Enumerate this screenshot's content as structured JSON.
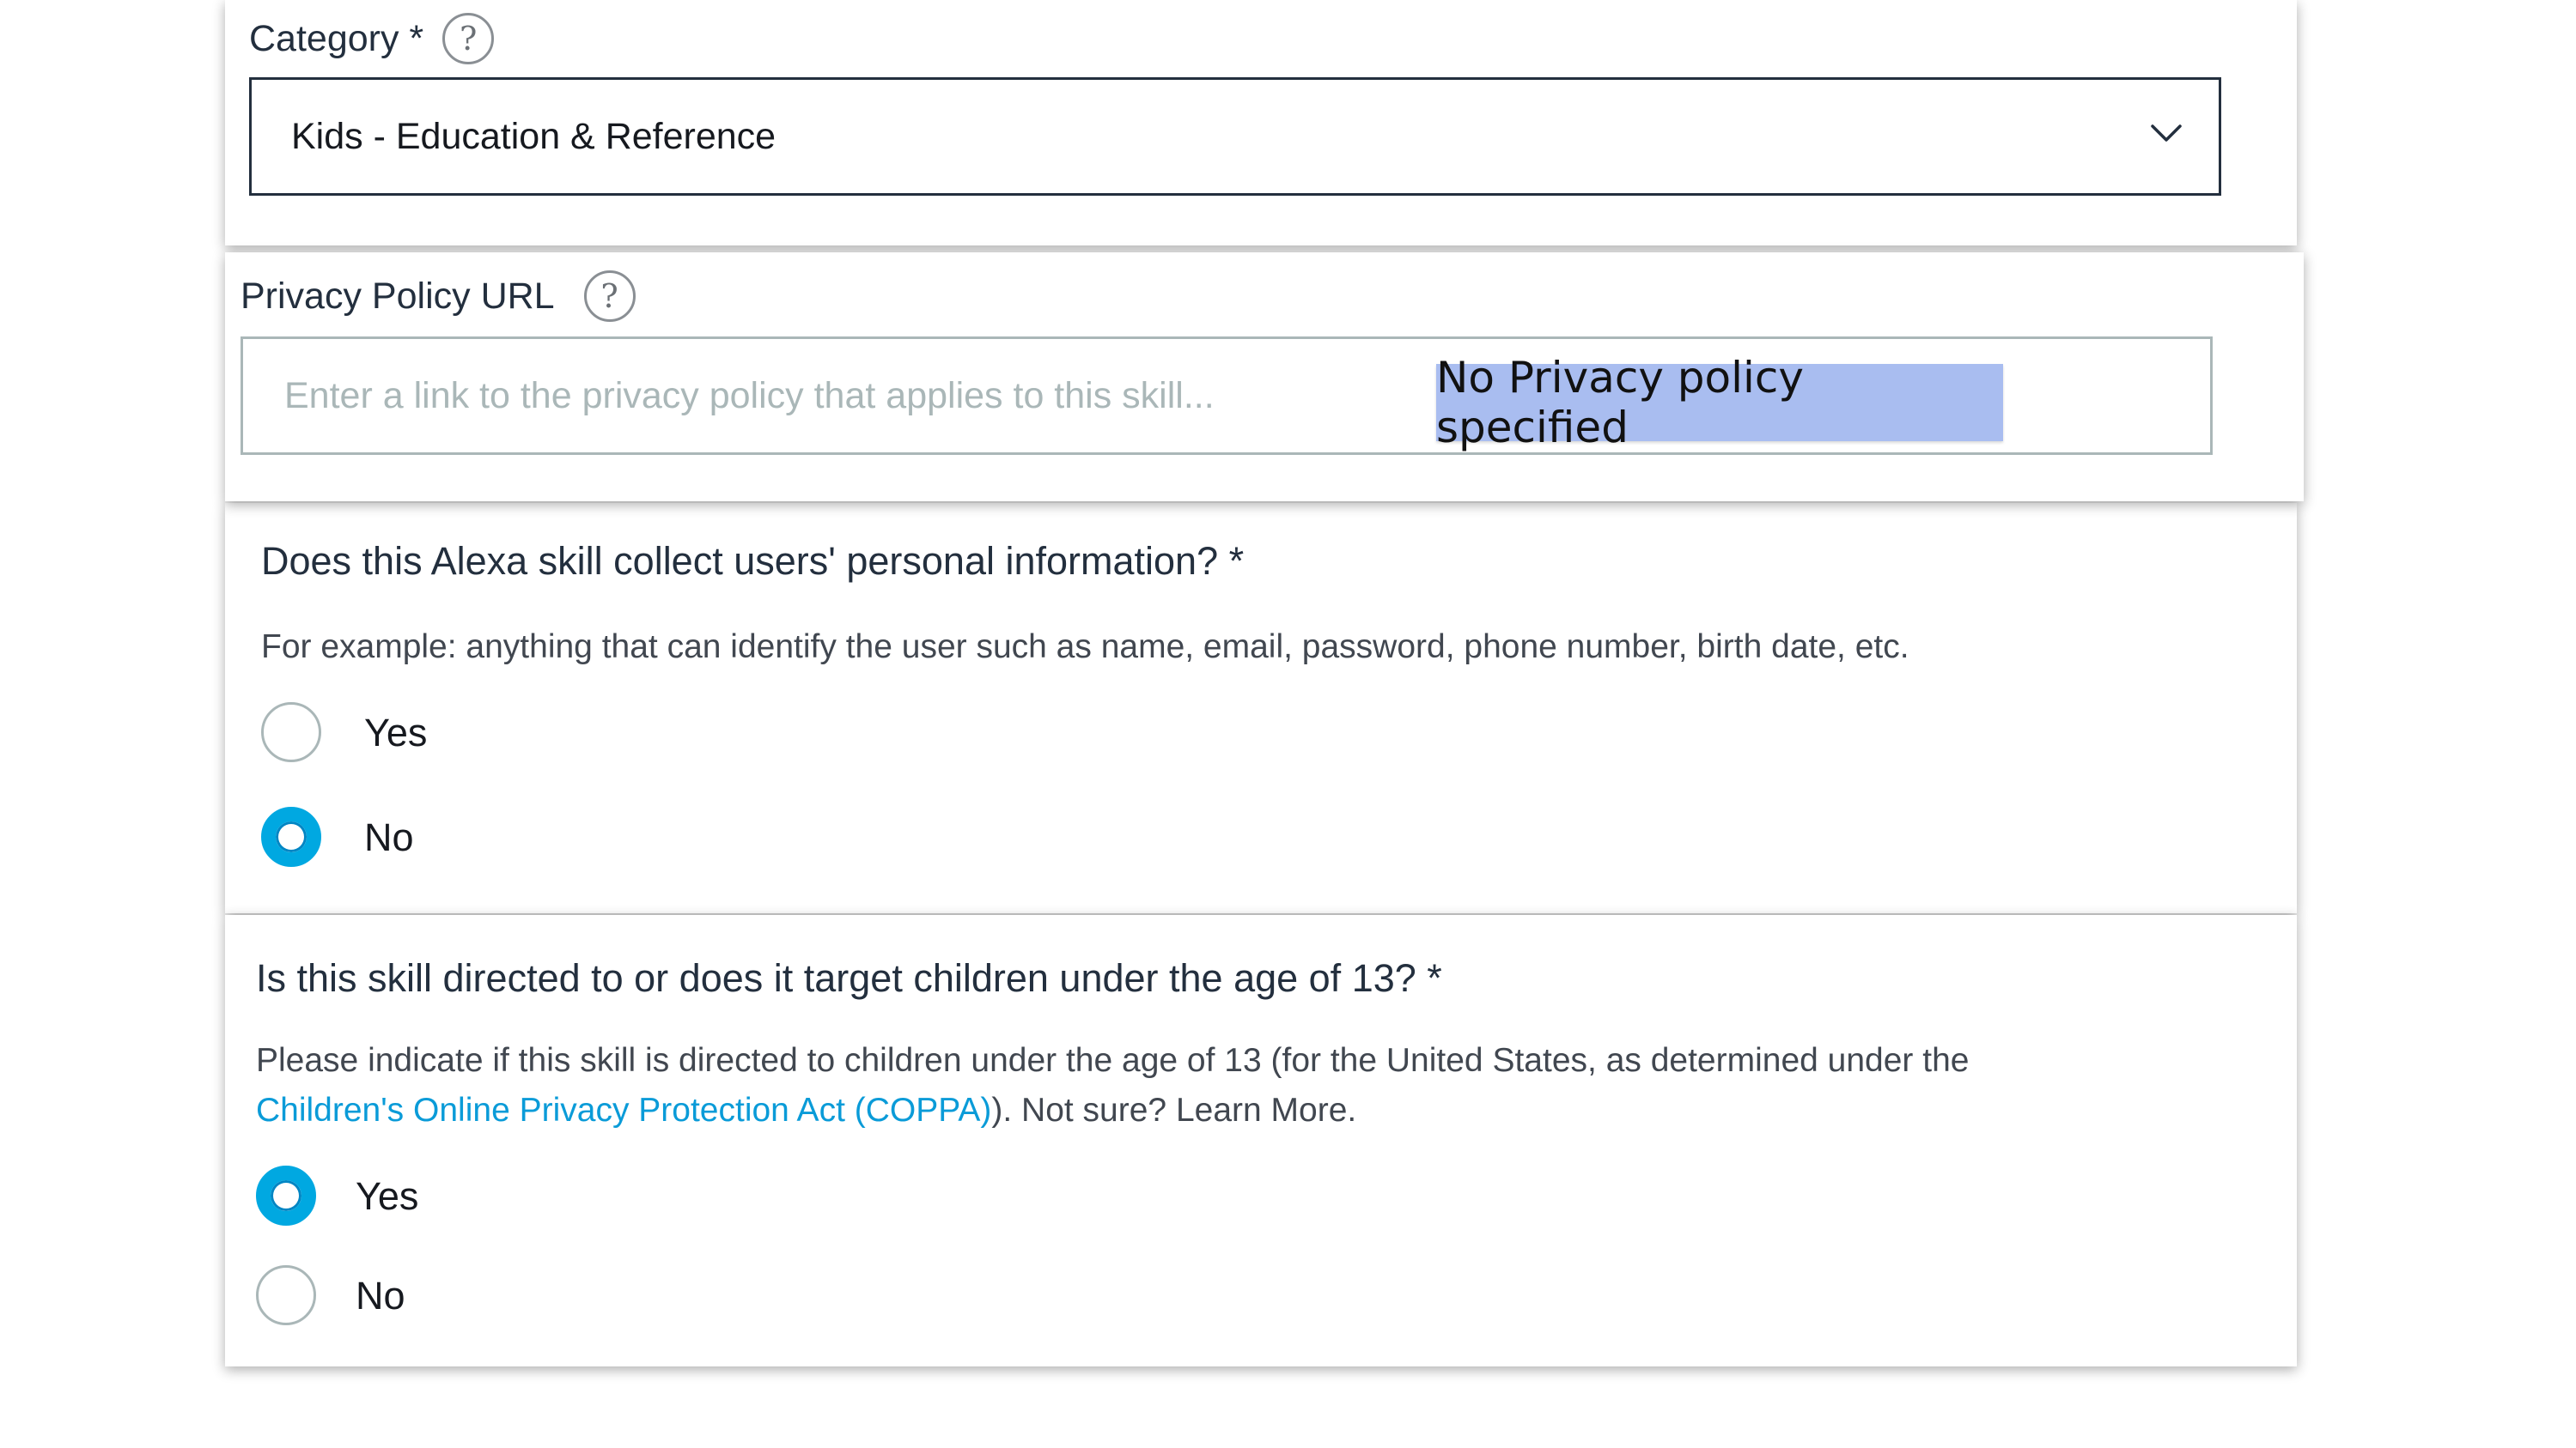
{
  "category": {
    "label": "Category *",
    "help_symbol": "?",
    "selected_value": "Kids - Education & Reference"
  },
  "privacy": {
    "label": "Privacy Policy URL",
    "help_symbol": "?",
    "placeholder": "Enter a link to the privacy policy that applies to this skill...",
    "annotation": "No Privacy policy specified"
  },
  "personal_info": {
    "question": "Does this Alexa skill collect users' personal information? *",
    "description": "For example: anything that can identify the user such as name, email, password, phone number, birth date, etc.",
    "options": [
      {
        "label": "Yes",
        "selected": false
      },
      {
        "label": "No",
        "selected": true
      }
    ]
  },
  "children": {
    "question": "Is this skill directed to or does it target children under the age of 13? *",
    "description_line1": "Please indicate if this skill is directed to children under the age of 13 (for the United States, as determined under the",
    "coppa_link": "Children's Online Privacy Protection Act (COPPA)",
    "description_tail": "). Not sure? Learn More.",
    "options": [
      {
        "label": "Yes",
        "selected": true
      },
      {
        "label": "No",
        "selected": false
      }
    ]
  },
  "colors": {
    "accent": "#00a8e1",
    "link": "#0a9bd8",
    "annotation_highlight": "#a9bdf0",
    "text": "#232f3e"
  },
  "icons": [
    "help-icon",
    "chevron-down-icon"
  ]
}
